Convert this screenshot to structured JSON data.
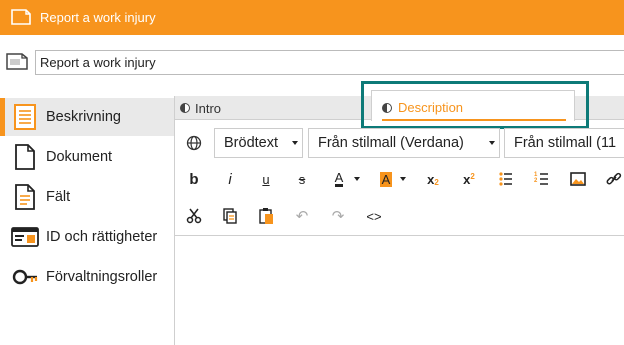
{
  "window": {
    "title": "Report a work injury"
  },
  "name_field": {
    "value": "Report a work injury"
  },
  "sidebar": {
    "items": [
      {
        "label": "Beskrivning",
        "icon": "description-doc-icon",
        "active": true
      },
      {
        "label": "Dokument",
        "icon": "document-icon"
      },
      {
        "label": "Fält",
        "icon": "fields-icon"
      },
      {
        "label": "ID och rättigheter",
        "icon": "id-card-icon"
      },
      {
        "label": "Förvaltningsroller",
        "icon": "admin-roles-icon"
      }
    ]
  },
  "tabs": [
    {
      "label": "Intro"
    },
    {
      "label": "Description",
      "selected": true
    }
  ],
  "toolbar": {
    "paragraph_style": "Brödtext",
    "font_family": "Från stilmall (Verdana)",
    "font_size": "Från stilmall (11",
    "buttons_row1": [
      "bold",
      "italic",
      "underline",
      "strikethrough",
      "text-color",
      "background-color",
      "subscript",
      "superscript",
      "bulleted-list",
      "numbered-list",
      "image",
      "link"
    ],
    "buttons_row2": [
      "cut",
      "copy",
      "paste",
      "undo",
      "redo",
      "source"
    ]
  },
  "colors": {
    "accent": "#f7941d",
    "highlight": "#0d7a78"
  }
}
